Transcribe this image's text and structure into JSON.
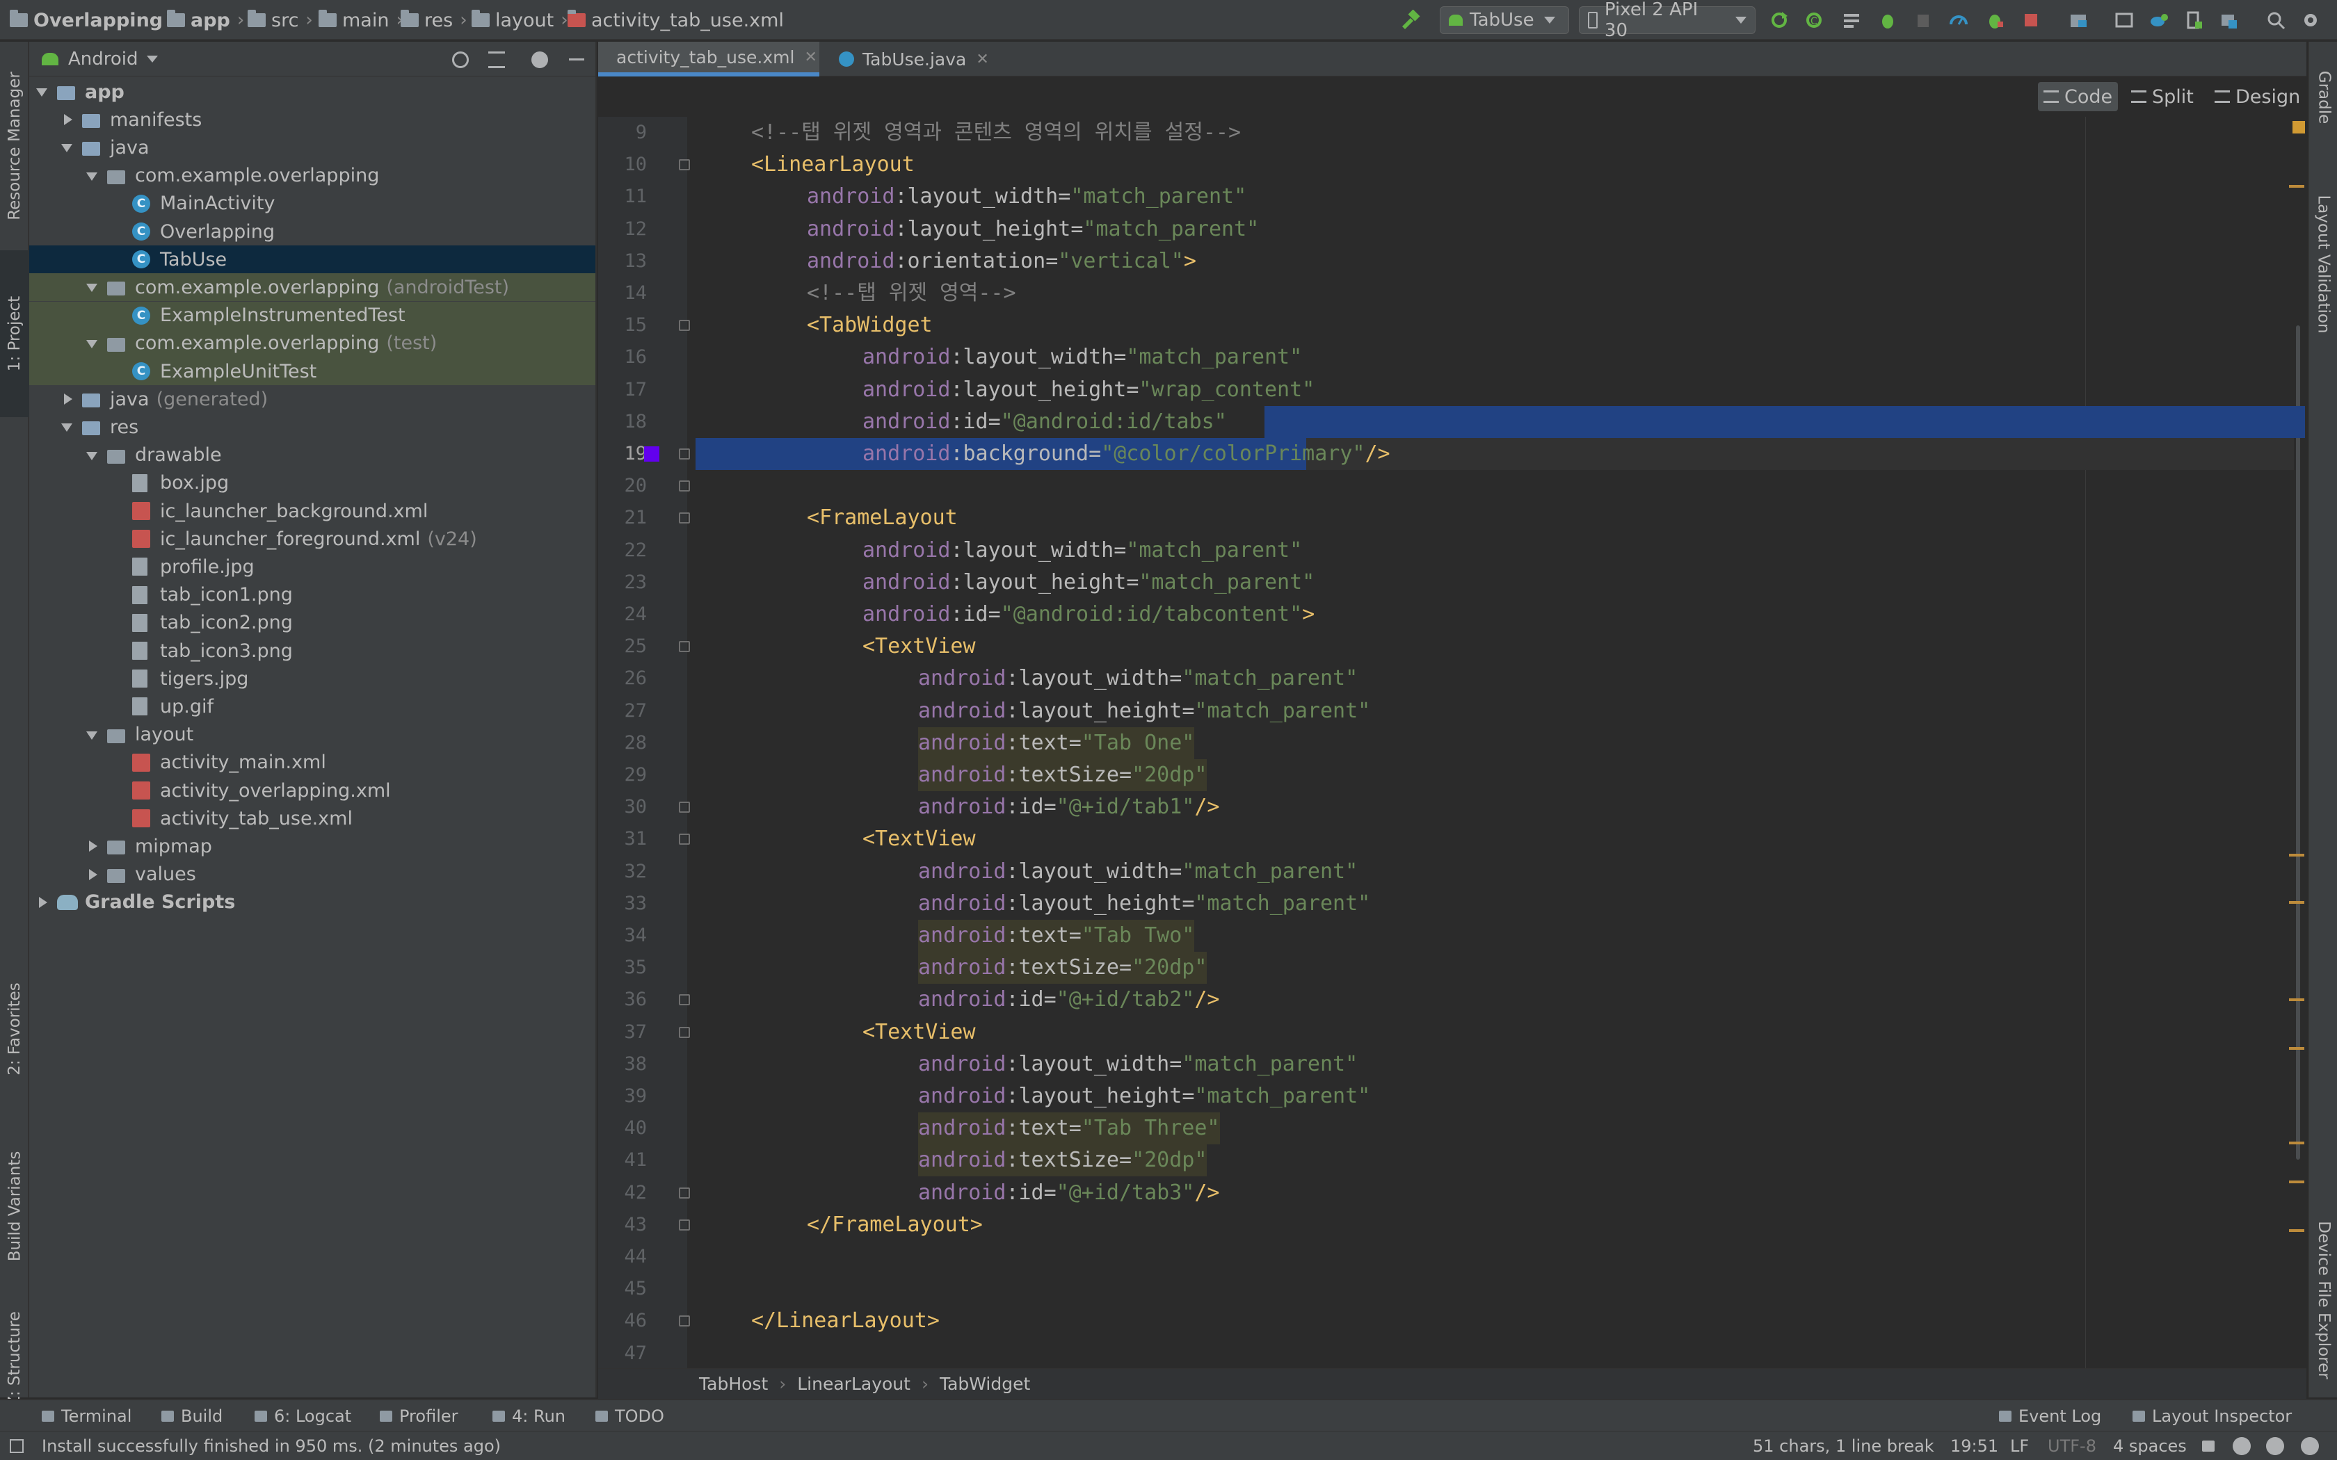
{
  "breadcrumb": [
    "Overlapping",
    "app",
    "src",
    "main",
    "res",
    "layout",
    "activity_tab_use.xml"
  ],
  "toolbar": {
    "run_config": "TabUse",
    "device": "Pixel 2 API 30"
  },
  "left_tool_windows": [
    "Resource Manager",
    "1: Project",
    "2: Favorites",
    "Build Variants",
    "Z: Structure"
  ],
  "right_tool_windows": [
    "Gradle",
    "Layout Validation",
    "Device File Explorer"
  ],
  "project": {
    "view": "Android",
    "tree": [
      {
        "label": "app",
        "note": ""
      },
      {
        "label": "manifests",
        "note": ""
      },
      {
        "label": "java",
        "note": ""
      },
      {
        "label": "com.example.overlapping",
        "note": ""
      },
      {
        "label": "MainActivity",
        "note": ""
      },
      {
        "label": "Overlapping",
        "note": ""
      },
      {
        "label": "TabUse",
        "note": ""
      },
      {
        "label": "com.example.overlapping",
        "note": "(androidTest)"
      },
      {
        "label": "ExampleInstrumentedTest",
        "note": ""
      },
      {
        "label": "com.example.overlapping",
        "note": "(test)"
      },
      {
        "label": "ExampleUnitTest",
        "note": ""
      },
      {
        "label": "java",
        "note": "(generated)"
      },
      {
        "label": "res",
        "note": ""
      },
      {
        "label": "drawable",
        "note": ""
      },
      {
        "label": "box.jpg",
        "note": ""
      },
      {
        "label": "ic_launcher_background.xml",
        "note": ""
      },
      {
        "label": "ic_launcher_foreground.xml",
        "note": "(v24)"
      },
      {
        "label": "profile.jpg",
        "note": ""
      },
      {
        "label": "tab_icon1.png",
        "note": ""
      },
      {
        "label": "tab_icon2.png",
        "note": ""
      },
      {
        "label": "tab_icon3.png",
        "note": ""
      },
      {
        "label": "tigers.jpg",
        "note": ""
      },
      {
        "label": "up.gif",
        "note": ""
      },
      {
        "label": "layout",
        "note": ""
      },
      {
        "label": "activity_main.xml",
        "note": ""
      },
      {
        "label": "activity_overlapping.xml",
        "note": ""
      },
      {
        "label": "activity_tab_use.xml",
        "note": ""
      },
      {
        "label": "mipmap",
        "note": ""
      },
      {
        "label": "values",
        "note": ""
      },
      {
        "label": "Gradle Scripts",
        "note": ""
      }
    ]
  },
  "editor_tabs": [
    {
      "label": "activity_tab_use.xml",
      "active": true
    },
    {
      "label": "TabUse.java",
      "active": false
    }
  ],
  "view_modes": [
    "Code",
    "Split",
    "Design"
  ],
  "code": {
    "line_numbers": [
      "9",
      "10",
      "11",
      "12",
      "13",
      "14",
      "15",
      "16",
      "17",
      "18",
      "19",
      "20",
      "21",
      "22",
      "23",
      "24",
      "25",
      "26",
      "27",
      "28",
      "29",
      "30",
      "31",
      "32",
      "33",
      "34",
      "35",
      "36",
      "37",
      "38",
      "39",
      "40",
      "41",
      "42",
      "43",
      "44",
      "45",
      "46",
      "47"
    ],
    "current_line": "19",
    "lines": [
      "<!--탭 위젯 영역과 콘텐츠 영역의 위치를 설정-->",
      "<LinearLayout",
      "android:layout_width=\"match_parent\"",
      "android:layout_height=\"match_parent\"",
      "android:orientation=\"vertical\">",
      "<!--탭 위젯 영역-->",
      "<TabWidget",
      "android:layout_width=\"match_parent\"",
      "android:layout_height=\"wrap_content\"",
      "android:id=\"@android:id/tabs\"",
      "android:background=\"@color/colorPrimary\"/>",
      "",
      "<FrameLayout",
      "android:layout_width=\"match_parent\"",
      "android:layout_height=\"match_parent\"",
      "android:id=\"@android:id/tabcontent\">",
      "<TextView",
      "android:layout_width=\"match_parent\"",
      "android:layout_height=\"match_parent\"",
      "android:text=\"Tab One\"",
      "android:textSize=\"20dp\"",
      "android:id=\"@+id/tab1\"/>",
      "<TextView",
      "android:layout_width=\"match_parent\"",
      "android:layout_height=\"match_parent\"",
      "android:text=\"Tab Two\"",
      "android:textSize=\"20dp\"",
      "android:id=\"@+id/tab2\"/>",
      "<TextView",
      "android:layout_width=\"match_parent\"",
      "android:layout_height=\"match_parent\"",
      "android:text=\"Tab Three\"",
      "android:textSize=\"20dp\"",
      "android:id=\"@+id/tab3\"/>",
      "</FrameLayout>",
      "",
      "",
      "</LinearLayout>",
      ""
    ]
  },
  "editor_breadcrumb": [
    "TabHost",
    "LinearLayout",
    "TabWidget"
  ],
  "bottom_tools": [
    {
      "label": "Terminal"
    },
    {
      "label": "Build"
    },
    {
      "label": "6: Logcat"
    },
    {
      "label": "Profiler"
    },
    {
      "label": "4: Run"
    },
    {
      "label": "TODO"
    },
    {
      "label": "Event Log"
    },
    {
      "label": "Layout Inspector"
    }
  ],
  "status": {
    "message": "Install successfully finished in 950 ms. (2 minutes ago)",
    "selection": "51 chars, 1 line break",
    "position": "19:51",
    "line_sep": "LF",
    "encoding": "UTF-8",
    "indent": "4 spaces"
  },
  "colors": {
    "selection": "#214283",
    "tag": "#e8bf6a",
    "namespace": "#9876aa",
    "value": "#6a8759",
    "comment": "#808080"
  }
}
